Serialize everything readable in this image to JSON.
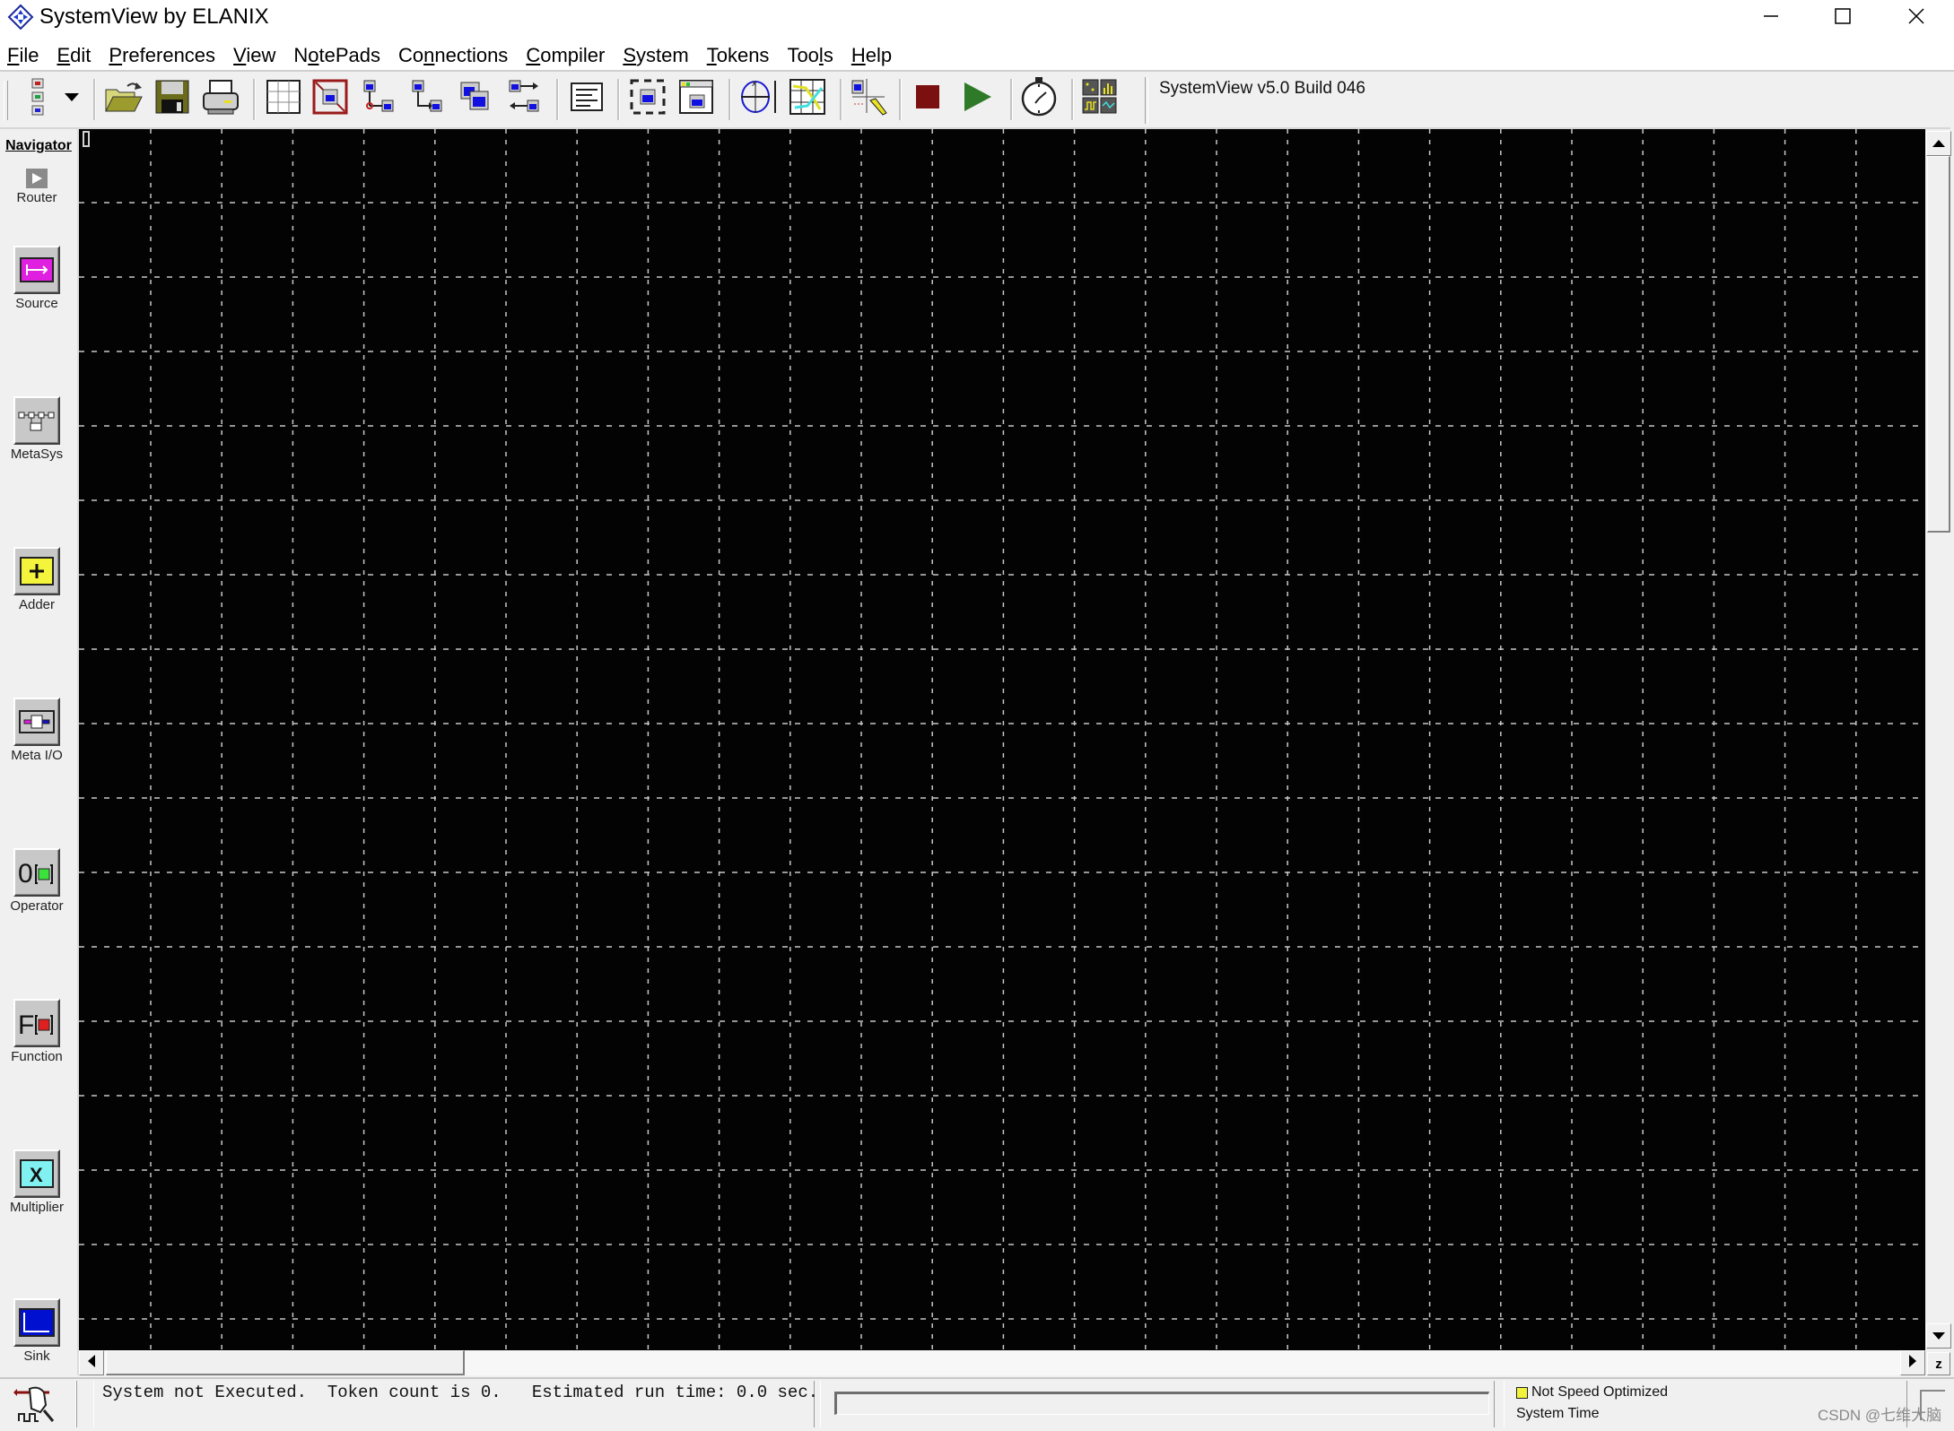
{
  "window": {
    "title": "SystemView by ELANIX",
    "icon": "elanix-diamond-icon",
    "controls": [
      "minimize-icon",
      "maximize-icon",
      "close-icon"
    ]
  },
  "menu": {
    "items": [
      {
        "label": "File",
        "mnemonic": "F"
      },
      {
        "label": "Edit",
        "mnemonic": "E"
      },
      {
        "label": "Preferences",
        "mnemonic": "P"
      },
      {
        "label": "View",
        "mnemonic": "V"
      },
      {
        "label": "NotePads",
        "mnemonic": "o"
      },
      {
        "label": "Connections",
        "mnemonic": "n"
      },
      {
        "label": "Compiler",
        "mnemonic": "C"
      },
      {
        "label": "System",
        "mnemonic": "S"
      },
      {
        "label": "Tokens",
        "mnemonic": "T"
      },
      {
        "label": "Tools",
        "mnemonic": "l"
      },
      {
        "label": "Help",
        "mnemonic": "H"
      }
    ]
  },
  "toolbar": {
    "buttons": [
      "token-library-icon",
      "dropdown-arrow-icon",
      "open-file-icon",
      "save-icon",
      "print-icon",
      "grid-icon",
      "delete-token-icon",
      "disconnect-tokens-icon",
      "connect-tokens-icon",
      "duplicate-token-icon",
      "reverse-token-icon",
      "notepad-icon",
      "create-metasystem-icon",
      "view-metasystem-icon",
      "root-locus-icon",
      "bode-plot-icon",
      "draw-token-icon",
      "stop-icon",
      "run-icon",
      "system-time-icon",
      "analysis-window-icon"
    ],
    "version_text": "SystemView v5.0 Build 046",
    "colors": {
      "stop": "#7a1010",
      "run": "#2f7a28"
    }
  },
  "navigator": {
    "title": "Navigator",
    "items": [
      {
        "label": "Router",
        "icon": "router-arrow-icon"
      },
      {
        "label": "Source",
        "icon": "source-icon",
        "color": "#e020e0"
      },
      {
        "label": "MetaSys",
        "icon": "metasys-icon"
      },
      {
        "label": "Adder",
        "icon": "adder-plus-icon",
        "color": "#f4f43c"
      },
      {
        "label": "Meta I/O",
        "icon": "meta-io-icon"
      },
      {
        "label": "Operator",
        "icon": "operator-icon",
        "color": "#3ce23c"
      },
      {
        "label": "Function",
        "icon": "function-icon",
        "color": "#e02020"
      },
      {
        "label": "Multiplier",
        "icon": "multiplier-x-icon",
        "color": "#80f0f0"
      },
      {
        "label": "Sink",
        "icon": "sink-icon",
        "color": "#0010d0"
      }
    ]
  },
  "canvas": {
    "background": "#030303",
    "grid_color": "#c8c8c8"
  },
  "statusbar": {
    "message": "System not Executed.  Token count is 0.   Estimated run time: 0.0 sec.",
    "speed_label": "Not Speed Optimized",
    "speed_indicator_color": "#f2f23c",
    "time_label": "System Time",
    "zoom_button": "z",
    "watermark": "CSDN @七维大脑"
  }
}
